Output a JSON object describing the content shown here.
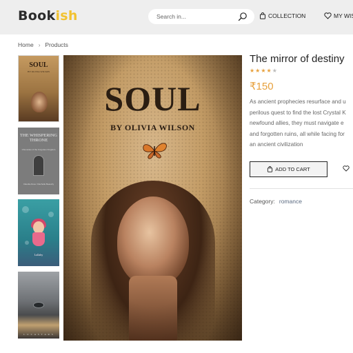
{
  "header": {
    "logo_part1": "Book",
    "logo_part2": "ish",
    "search_placeholder": "Search in...",
    "nav": {
      "collection": "COLLECTION",
      "wishlist": "MY WIS"
    }
  },
  "breadcrumb": {
    "items": [
      "Home",
      "Products"
    ]
  },
  "thumbnails": [
    {
      "title": "SOUL",
      "subtitle": "BY OLIVIA WILSON"
    },
    {
      "title": "THE WHISPERING THRONE",
      "subtitle": "Chronicles of the Forgotten Kingdom",
      "author": "Claudia Alves / Rachelle Beaudry"
    },
    {
      "title": "Lullaby"
    },
    {
      "title": "L U C A  S T A R S"
    }
  ],
  "cover": {
    "title": "SOUL",
    "author": "BY OLIVIA WILSON"
  },
  "product": {
    "title": "The mirror of destiny",
    "rating": 4,
    "rating_max": 5,
    "price": "₹150",
    "description_lines": [
      "As ancient prophecies resurface and u",
      "perilous quest to find the lost Crystal K",
      "newfound allies, they must navigate e",
      "and forgotten ruins, all while facing for",
      "an ancient civilization"
    ],
    "add_to_cart": "ADD TO CART",
    "category_label": "Category:",
    "category_value": "romance"
  },
  "colors": {
    "accent": "#e7a03c",
    "logo_yellow": "#f2c230",
    "star_filled": "#e7a03c",
    "star_empty": "#bbbbbb"
  }
}
